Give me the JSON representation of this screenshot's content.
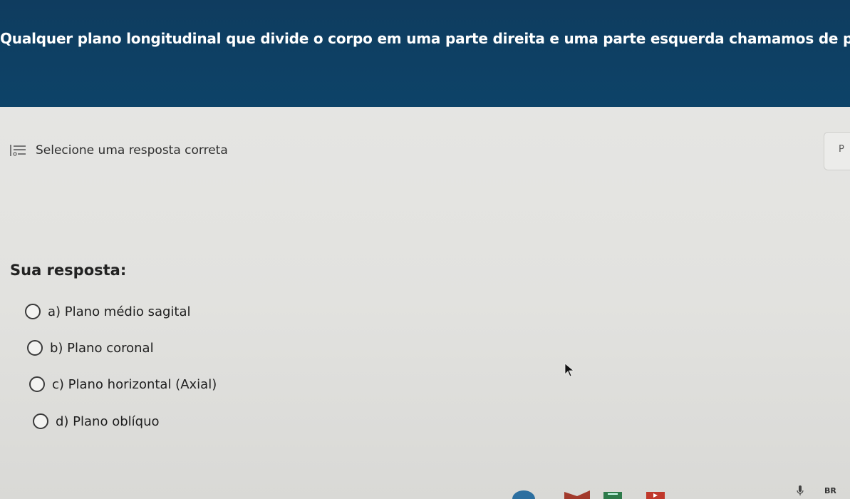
{
  "question": {
    "text": "Qualquer plano longitudinal que divide o corpo em uma parte direita e uma parte esquerda chamamos de plano:"
  },
  "instruction": {
    "icon": "list-select-icon",
    "text": "Selecione uma resposta correta"
  },
  "side_tab": {
    "label": "P"
  },
  "answer": {
    "title": "Sua resposta:",
    "options": [
      {
        "label": "a) Plano médio sagital",
        "selected": false
      },
      {
        "label": "b) Plano coronal",
        "selected": false
      },
      {
        "label": "c) Plano horizontal (Axial)",
        "selected": false
      },
      {
        "label": "d) Plano oblíquo",
        "selected": false
      }
    ]
  },
  "taskbar": {
    "language": "BR",
    "icons": [
      "microphone-icon"
    ]
  },
  "colors": {
    "header_bg": "#0d4368",
    "header_text": "#ffffff",
    "page_bg": "#e4e4e2"
  }
}
